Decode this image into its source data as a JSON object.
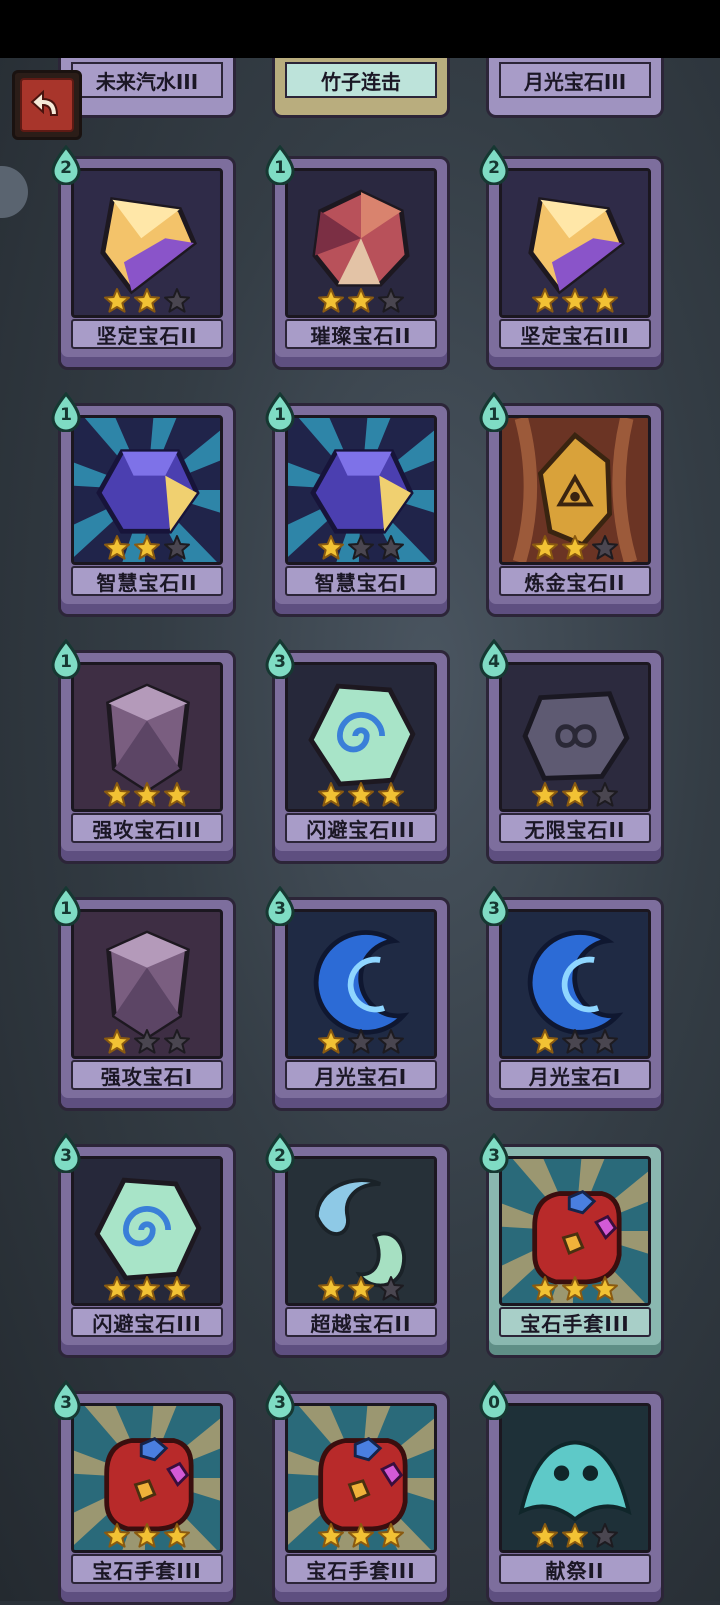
{
  "top_row": [
    {
      "name": "未来汽水III"
    },
    {
      "name": "竹子连击"
    },
    {
      "name": "月光宝石III"
    }
  ],
  "cards": [
    {
      "name": "坚定宝石II",
      "cost": "2",
      "stars": 2,
      "art": "amber-crystal"
    },
    {
      "name": "璀璨宝石II",
      "cost": "1",
      "stars": 2,
      "art": "faceted-gem"
    },
    {
      "name": "坚定宝石III",
      "cost": "2",
      "stars": 3,
      "art": "amber-crystal"
    },
    {
      "name": "智慧宝石II",
      "cost": "1",
      "stars": 2,
      "art": "blue-gem-rays"
    },
    {
      "name": "智慧宝石I",
      "cost": "1",
      "stars": 1,
      "art": "blue-gem-rays"
    },
    {
      "name": "炼金宝石II",
      "cost": "1",
      "stars": 2,
      "art": "gold-triangle-gem"
    },
    {
      "name": "强攻宝石III",
      "cost": "1",
      "stars": 3,
      "art": "violet-shield-gem"
    },
    {
      "name": "闪避宝石III",
      "cost": "3",
      "stars": 3,
      "art": "swirl-gem"
    },
    {
      "name": "无限宝石II",
      "cost": "4",
      "stars": 2,
      "art": "infinity-stone"
    },
    {
      "name": "强攻宝石I",
      "cost": "1",
      "stars": 1,
      "art": "violet-shield-gem"
    },
    {
      "name": "月光宝石I",
      "cost": "3",
      "stars": 1,
      "art": "moon-gem"
    },
    {
      "name": "月光宝石I",
      "cost": "3",
      "stars": 1,
      "art": "moon-gem"
    },
    {
      "name": "闪避宝石III",
      "cost": "3",
      "stars": 3,
      "art": "swirl-gem"
    },
    {
      "name": "超越宝石II",
      "cost": "2",
      "stars": 2,
      "art": "comma-gems"
    },
    {
      "name": "宝石手套III",
      "cost": "3",
      "stars": 3,
      "art": "gem-gauntlet",
      "teal": true
    },
    {
      "name": "宝石手套III",
      "cost": "3",
      "stars": 3,
      "art": "gem-gauntlet"
    },
    {
      "name": "宝石手套III",
      "cost": "3",
      "stars": 3,
      "art": "gem-gauntlet"
    },
    {
      "name": "献祭II",
      "cost": "0",
      "stars": 2,
      "art": "spirit-sacrifice"
    }
  ],
  "colors": {
    "card_purple": "#7d6e9d",
    "card_teal": "#8ab8b0",
    "star_gold": "#f2c234",
    "star_empty": "#4a4650",
    "cost_drop": "#7fdcc4",
    "back_button_red": "#a8352b"
  },
  "icons": {
    "back": "back-arrow-icon",
    "cost": "spirit-drop-icon",
    "star": "star-icon"
  }
}
